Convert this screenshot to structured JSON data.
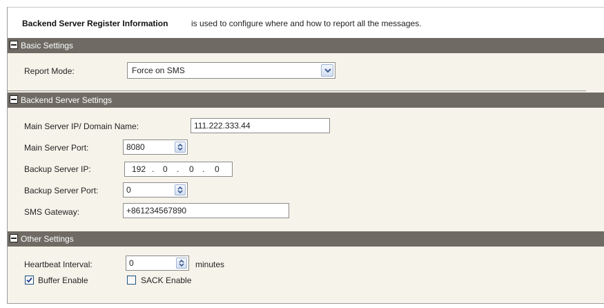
{
  "header": {
    "title": "Backend Server Register Information",
    "description": "is used to configure where and how to report all the messages."
  },
  "sections": {
    "basic": {
      "title": "Basic Settings"
    },
    "backend": {
      "title": "Backend Server Settings"
    },
    "other": {
      "title": "Other Settings"
    }
  },
  "basic": {
    "report_mode_label": "Report Mode:",
    "report_mode_value": "Force on SMS"
  },
  "backend": {
    "main_ip_label": "Main Server IP/ Domain Name:",
    "main_ip_value": "111.222.333.44",
    "main_port_label": "Main Server Port:",
    "main_port_value": "8080",
    "backup_ip_label": "Backup Server IP:",
    "backup_ip": [
      "192",
      "0",
      "0",
      "0"
    ],
    "backup_ip_dot": ".",
    "backup_port_label": "Backup Server Port:",
    "backup_port_value": "0",
    "sms_label": "SMS Gateway:",
    "sms_value": "+861234567890"
  },
  "other": {
    "heartbeat_label": "Heartbeat Interval:",
    "heartbeat_value": "0",
    "heartbeat_unit": "minutes",
    "buffer_label": "Buffer Enable",
    "buffer_checked": true,
    "sack_label": "SACK Enable",
    "sack_checked": false
  },
  "icons": {
    "collapse": "minus-box-icon",
    "dropdown": "chevron-down-icon",
    "spinner": "up-down-arrows-icon",
    "check": "checkmark-icon"
  },
  "colors": {
    "section_header": "#6f6b64",
    "panel_background": "#f6f3ea",
    "control_accent": "#9fb3d2"
  }
}
